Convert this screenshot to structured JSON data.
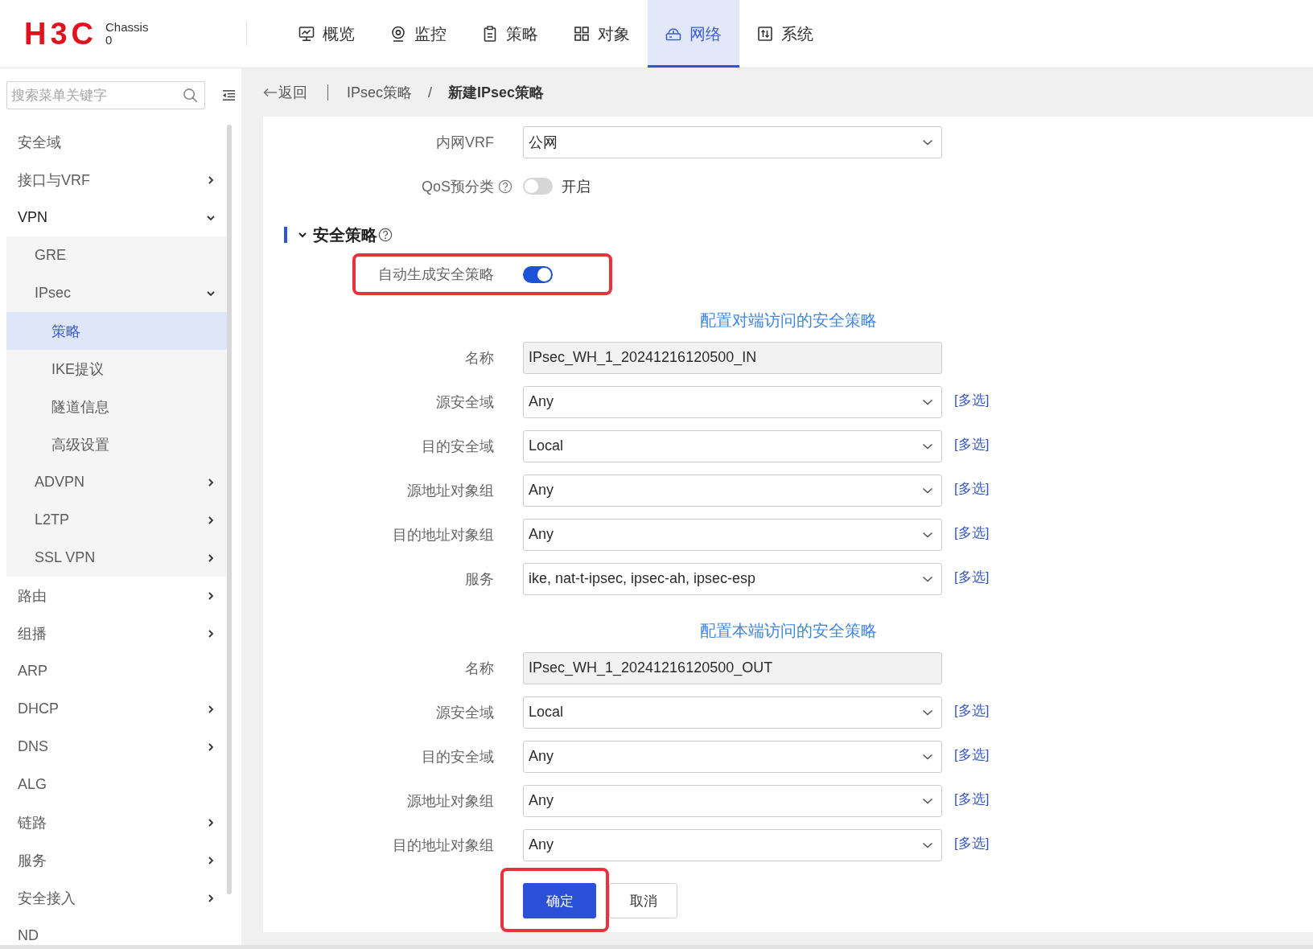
{
  "header": {
    "logo": "H3C",
    "device_label": "Chassis",
    "device_value": "0",
    "nav": [
      {
        "label": "概览",
        "selected": false
      },
      {
        "label": "监控",
        "selected": false
      },
      {
        "label": "策略",
        "selected": false
      },
      {
        "label": "对象",
        "selected": false
      },
      {
        "label": "网络",
        "selected": true
      },
      {
        "label": "系统",
        "selected": false
      }
    ]
  },
  "sidebar": {
    "search": {
      "placeholder": "搜索菜单关键字"
    },
    "items": [
      {
        "label": "安全域",
        "kind": "leaf",
        "selected": false
      },
      {
        "label": "接口与VRF",
        "kind": "group",
        "expanded": false,
        "selected": false
      },
      {
        "label": "VPN",
        "kind": "group",
        "expanded": true,
        "selected": false,
        "children": [
          {
            "label": "GRE",
            "kind": "leaf",
            "selected": false
          },
          {
            "label": "IPsec",
            "kind": "group",
            "expanded": true,
            "selected": false,
            "children": [
              {
                "label": "策略",
                "kind": "leaf",
                "selected": true
              },
              {
                "label": "IKE提议",
                "kind": "leaf",
                "selected": false
              },
              {
                "label": "隧道信息",
                "kind": "leaf",
                "selected": false
              },
              {
                "label": "高级设置",
                "kind": "leaf",
                "selected": false
              }
            ]
          },
          {
            "label": "ADVPN",
            "kind": "group",
            "expanded": false,
            "selected": false
          },
          {
            "label": "L2TP",
            "kind": "group",
            "expanded": false,
            "selected": false
          },
          {
            "label": "SSL VPN",
            "kind": "group",
            "expanded": false,
            "selected": false
          }
        ]
      },
      {
        "label": "路由",
        "kind": "group",
        "expanded": false,
        "selected": false
      },
      {
        "label": "组播",
        "kind": "group",
        "expanded": false,
        "selected": false
      },
      {
        "label": "ARP",
        "kind": "leaf",
        "selected": false
      },
      {
        "label": "DHCP",
        "kind": "group",
        "expanded": false,
        "selected": false
      },
      {
        "label": "DNS",
        "kind": "group",
        "expanded": false,
        "selected": false
      },
      {
        "label": "ALG",
        "kind": "leaf",
        "selected": false
      },
      {
        "label": "链路",
        "kind": "group",
        "expanded": false,
        "selected": false
      },
      {
        "label": "服务",
        "kind": "group",
        "expanded": false,
        "selected": false
      },
      {
        "label": "安全接入",
        "kind": "group",
        "expanded": false,
        "selected": false
      },
      {
        "label": "ND",
        "kind": "leaf",
        "selected": false
      }
    ]
  },
  "breadcrumb": {
    "back": "返回",
    "separator": "/",
    "items": [
      {
        "label": "IPsec策略",
        "current": false
      },
      {
        "label": "新建IPsec策略",
        "current": true
      }
    ]
  },
  "form": {
    "rows": [
      {
        "label": "内网VRF",
        "kind": "select",
        "value": "公网"
      },
      {
        "label": "QoS预分类",
        "kind": "switch",
        "help": true,
        "on": false,
        "switch_label": "开启"
      }
    ],
    "section": {
      "title": "安全策略",
      "expanded": true,
      "help": true,
      "auto_policy": {
        "label": "自动生成安全策略",
        "on": true,
        "highlighted": true
      },
      "groups": [
        {
          "link": "配置对端访问的安全策略",
          "fields": [
            {
              "label": "名称",
              "kind": "readonly",
              "value": "IPsec_WH_1_20241216120500_IN"
            },
            {
              "label": "源安全域",
              "kind": "select",
              "value": "Any",
              "multi": "[多选]"
            },
            {
              "label": "目的安全域",
              "kind": "select",
              "value": "Local",
              "multi": "[多选]"
            },
            {
              "label": "源地址对象组",
              "kind": "select",
              "value": "Any",
              "multi": "[多选]"
            },
            {
              "label": "目的地址对象组",
              "kind": "select",
              "value": "Any",
              "multi": "[多选]"
            },
            {
              "label": "服务",
              "kind": "select",
              "value": "ike, nat-t-ipsec, ipsec-ah, ipsec-esp",
              "multi": "[多选]"
            }
          ]
        },
        {
          "link": "配置本端访问的安全策略",
          "fields": [
            {
              "label": "名称",
              "kind": "readonly",
              "value": "IPsec_WH_1_20241216120500_OUT"
            },
            {
              "label": "源安全域",
              "kind": "select",
              "value": "Local",
              "multi": "[多选]"
            },
            {
              "label": "目的安全域",
              "kind": "select",
              "value": "Any",
              "multi": "[多选]"
            },
            {
              "label": "源地址对象组",
              "kind": "select",
              "value": "Any",
              "multi": "[多选]"
            },
            {
              "label": "目的地址对象组",
              "kind": "select",
              "value": "Any",
              "multi": "[多选]"
            }
          ]
        }
      ]
    }
  },
  "actions": [
    {
      "label": "确定",
      "kind": "primary",
      "highlighted": true
    },
    {
      "label": "取消",
      "kind": "secondary",
      "highlighted": false
    }
  ]
}
